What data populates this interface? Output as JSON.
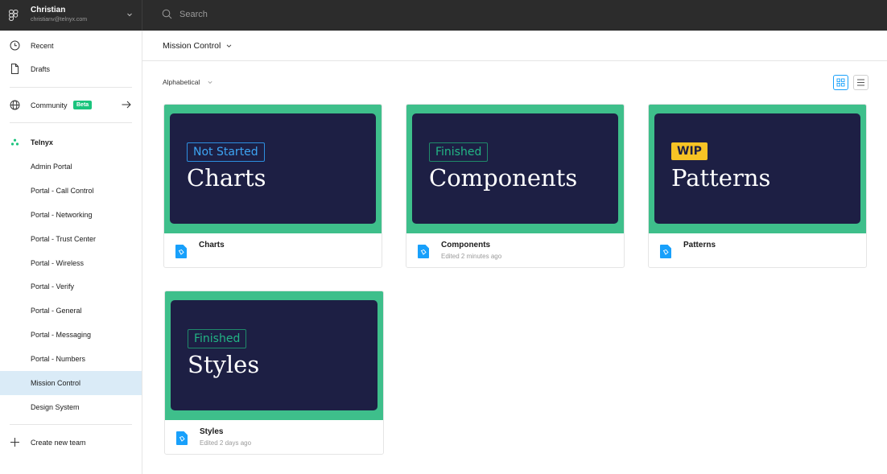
{
  "account": {
    "name": "Christian",
    "email": "christianv@telnyx.com"
  },
  "search": {
    "placeholder": "Search"
  },
  "sidebar": {
    "recent": "Recent",
    "drafts": "Drafts",
    "community": "Community",
    "community_badge": "Beta",
    "team_name": "Telnyx",
    "projects": [
      "Admin Portal",
      "Portal - Call Control",
      "Portal - Networking",
      "Portal - Trust Center",
      "Portal - Wireless",
      "Portal - Verify",
      "Portal - General",
      "Portal - Messaging",
      "Portal - Numbers",
      "Mission Control",
      "Design System"
    ],
    "active_project": "Mission Control",
    "create_team": "Create new team"
  },
  "main": {
    "project_title": "Mission Control",
    "sort_label": "Alphabetical",
    "files": [
      {
        "name": "Charts",
        "edited": "",
        "status": "Not Started",
        "thumb_title": "Charts"
      },
      {
        "name": "Components",
        "edited": "Edited 2 minutes ago",
        "status": "Finished",
        "thumb_title": "Components"
      },
      {
        "name": "Patterns",
        "edited": "",
        "status": "WIP",
        "thumb_title": "Patterns"
      },
      {
        "name": "Styles",
        "edited": "Edited 2 days ago",
        "status": "Finished",
        "thumb_title": "Styles"
      }
    ]
  },
  "colors": {
    "thumb_green": "#3ebf8b",
    "panel_navy": "#1d1f44",
    "accent_blue": "#18a0fb",
    "beta_green": "#1bc47d",
    "wip_yellow": "#f7c325"
  }
}
